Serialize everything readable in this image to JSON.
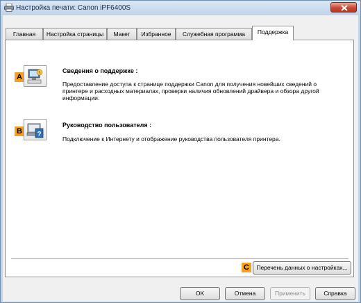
{
  "window": {
    "title": "Настройка печати: Canon iPF6400S",
    "close_icon": "close-x-icon",
    "printer_icon": "printer-icon",
    "colors": {
      "frame": "#c4d6ea",
      "close_red": "#c94a32",
      "badge_orange": "#f7a01e"
    }
  },
  "tabs": [
    {
      "label": "Главная",
      "active": false
    },
    {
      "label": "Настройка страницы",
      "active": false
    },
    {
      "label": "Макет",
      "active": false
    },
    {
      "label": "Избранное",
      "active": false
    },
    {
      "label": "Служебная программа",
      "active": false
    },
    {
      "label": "Поддержка",
      "active": true
    }
  ],
  "support": {
    "items": [
      {
        "badge": "A",
        "icon": "support-computer-icon",
        "title": "Сведения о поддержке :",
        "description": "Предоставление доступа к странице поддержки Canon для получения новейших сведений о принтере и расходных материалах, проверки наличия обновлений драйвера и обзора другой информации."
      },
      {
        "badge": "B",
        "icon": "user-manual-icon",
        "title": "Руководство пользователя :",
        "description": "Подключение к Интернету и отображение руководства пользователя принтера."
      }
    ],
    "settings_list": {
      "badge": "C",
      "label": "Перечень данных о настройках..."
    }
  },
  "footer": {
    "ok_label": "OK",
    "cancel_label": "Отмена",
    "apply_label": "Применить",
    "help_label": "Справка"
  }
}
